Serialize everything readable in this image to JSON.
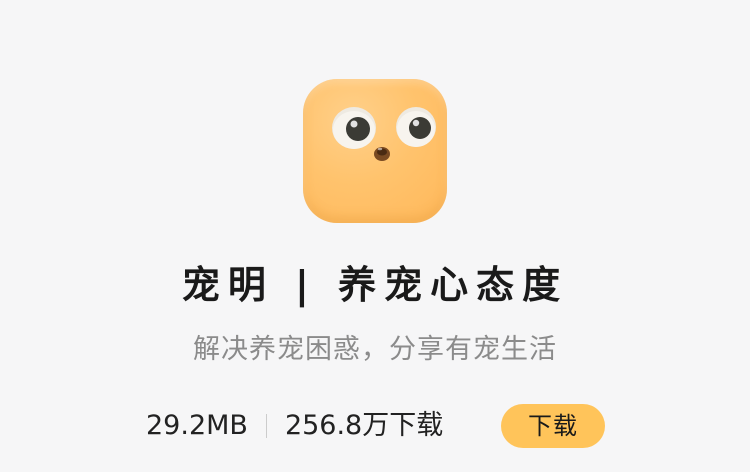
{
  "app": {
    "title": "宠明 | 养宠心态度",
    "subtitle": "解决养宠困惑，分享有宠生活",
    "icon_name": "puppy-face-icon",
    "size": "29.2MB",
    "downloads": "256.8万下载",
    "download_label": "下载"
  },
  "colors": {
    "background": "#f6f6f7",
    "icon_orange": "#ffc36d",
    "button": "#ffc45a",
    "title": "#1a1a1a",
    "subtitle": "#8b8b8b"
  }
}
